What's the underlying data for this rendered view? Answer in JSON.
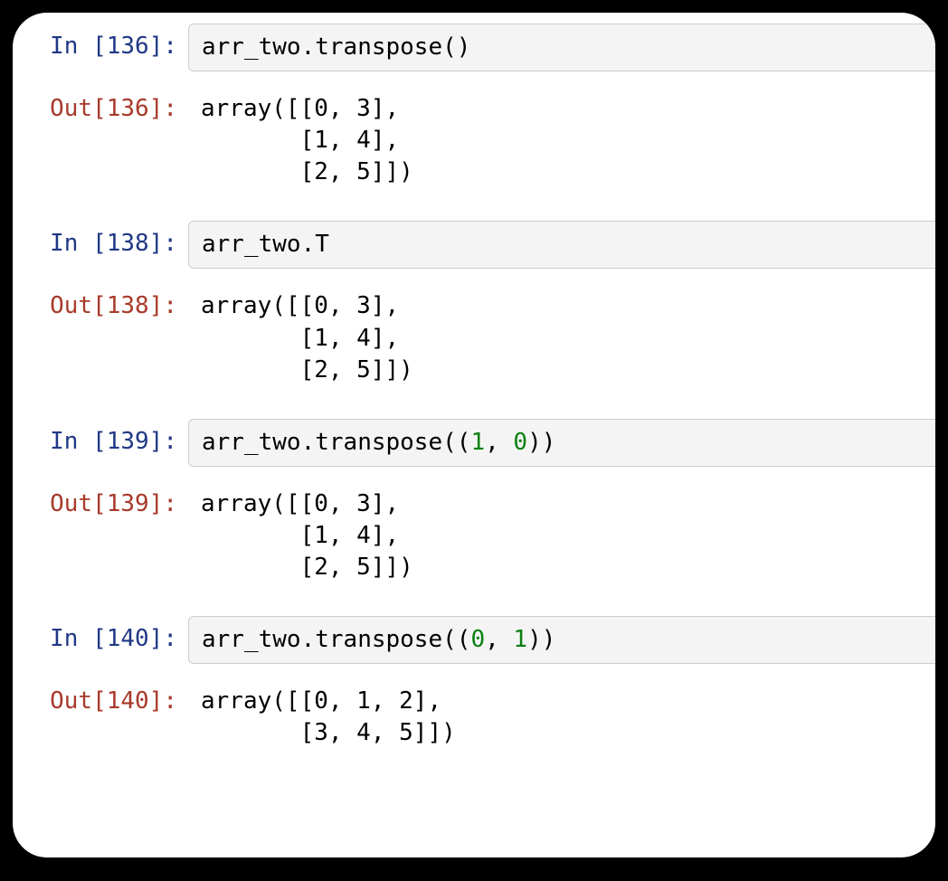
{
  "cells": [
    {
      "kind": "in",
      "n": 136,
      "prompt": "In [136]:",
      "tokens": [
        "arr_two",
        ".",
        "transpose",
        "(",
        ")"
      ],
      "types": [
        "plain",
        "plain",
        "plain",
        "plain",
        "plain"
      ]
    },
    {
      "kind": "out",
      "n": 136,
      "prompt": "Out[136]:",
      "text": "array([[0, 3],\n       [1, 4],\n       [2, 5]])"
    },
    {
      "kind": "in",
      "n": 138,
      "prompt": "In [138]:",
      "tokens": [
        "arr_two",
        ".",
        "T"
      ],
      "types": [
        "plain",
        "plain",
        "plain"
      ]
    },
    {
      "kind": "out",
      "n": 138,
      "prompt": "Out[138]:",
      "text": "array([[0, 3],\n       [1, 4],\n       [2, 5]])"
    },
    {
      "kind": "in",
      "n": 139,
      "prompt": "In [139]:",
      "tokens": [
        "arr_two",
        ".",
        "transpose",
        "(",
        "(",
        "1",
        ", ",
        "0",
        ")",
        ")"
      ],
      "types": [
        "plain",
        "plain",
        "plain",
        "plain",
        "plain",
        "num",
        "plain",
        "num",
        "plain",
        "plain"
      ]
    },
    {
      "kind": "out",
      "n": 139,
      "prompt": "Out[139]:",
      "text": "array([[0, 3],\n       [1, 4],\n       [2, 5]])"
    },
    {
      "kind": "in",
      "n": 140,
      "prompt": "In [140]:",
      "tokens": [
        "arr_two",
        ".",
        "transpose",
        "(",
        "(",
        "0",
        ", ",
        "1",
        ")",
        ")"
      ],
      "types": [
        "plain",
        "plain",
        "plain",
        "plain",
        "plain",
        "num",
        "plain",
        "num",
        "plain",
        "plain"
      ]
    },
    {
      "kind": "out",
      "n": 140,
      "prompt": "Out[140]:",
      "text": "array([[0, 1, 2],\n       [3, 4, 5]])"
    }
  ]
}
